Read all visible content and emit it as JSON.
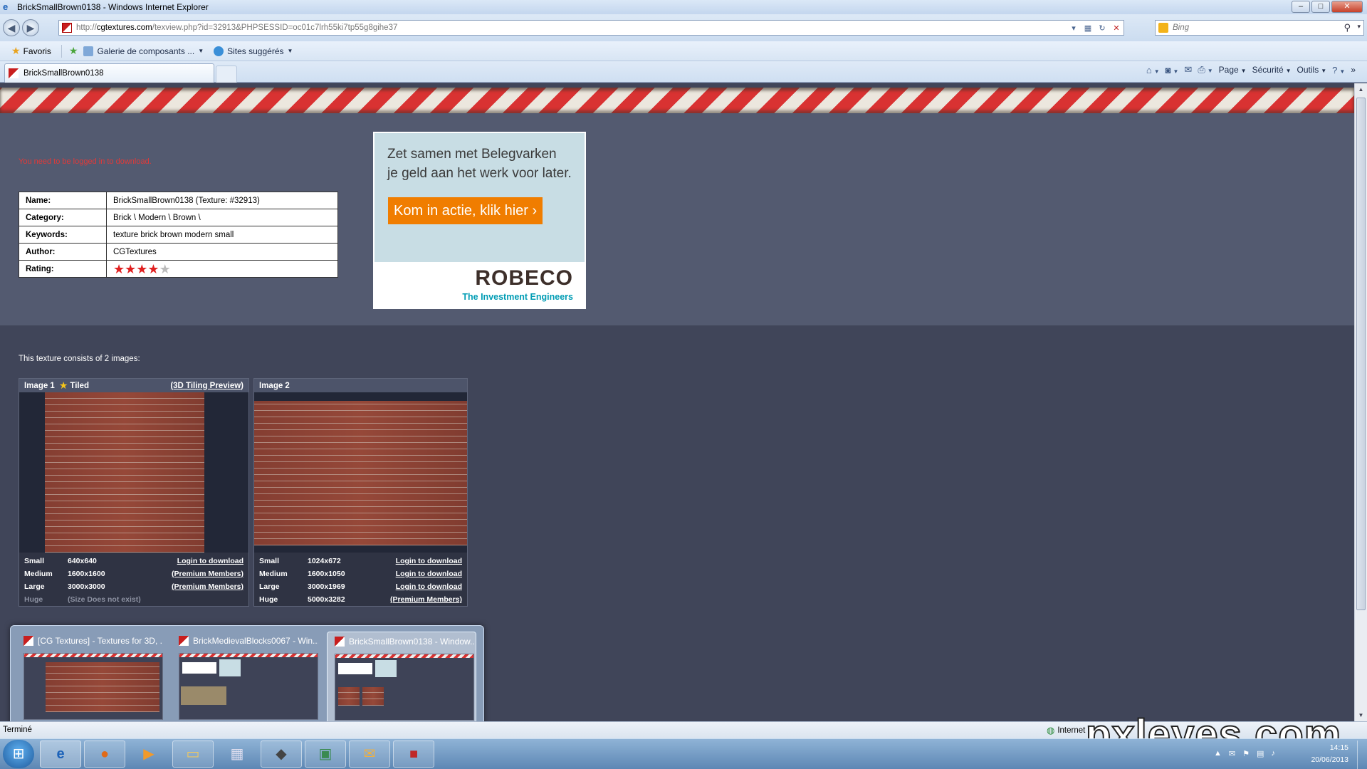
{
  "window": {
    "title": "BrickSmallBrown0138 - Windows Internet Explorer",
    "minimize": "–",
    "maximize": "□",
    "close": "✕"
  },
  "nav": {
    "back": "◀",
    "forward": "▶",
    "url_prefix": "http://",
    "url_host": "cgtextures.com",
    "url_path": "/texview.php?id=32913&PHPSESSID=oc01c7lrh55ki7tp55g8gihe37",
    "search_placeholder": "Bing"
  },
  "favorites": {
    "favorites_label": "Favoris",
    "items": [
      "Galerie de composants ...",
      "Sites suggérés"
    ]
  },
  "tab": {
    "label": "BrickSmallBrown0138"
  },
  "commands": {
    "page": "Page",
    "security": "Sécurité",
    "tools": "Outils",
    "help": "?",
    "more": "»"
  },
  "content": {
    "login_message": "You need to be logged in to download.",
    "info": [
      {
        "key": "Name:",
        "value": "BrickSmallBrown0138 (Texture: #32913)"
      },
      {
        "key": "Category:",
        "value": "Brick \\ Modern \\ Brown \\"
      },
      {
        "key": "Keywords:",
        "value": "texture brick brown modern small"
      },
      {
        "key": "Author:",
        "value": "CGTextures"
      },
      {
        "key": "Rating:",
        "value": ""
      }
    ],
    "rating": {
      "stars": 4,
      "max": 5
    },
    "consists": "This texture consists of 2 images:",
    "images": [
      {
        "title": "Image 1",
        "tiled": "Tiled",
        "preview_link": "(3D Tiling Preview)",
        "sizes": [
          {
            "size": "Small",
            "dim": "640x640",
            "action": "Login to download",
            "available": true
          },
          {
            "size": "Medium",
            "dim": "1600x1600",
            "action": "(Premium Members)",
            "available": true
          },
          {
            "size": "Large",
            "dim": "3000x3000",
            "action": "(Premium Members)",
            "available": true
          },
          {
            "size": "Huge",
            "dim": "(Size Does not exist)",
            "action": "",
            "available": false
          }
        ]
      },
      {
        "title": "Image 2",
        "sizes": [
          {
            "size": "Small",
            "dim": "1024x672",
            "action": "Login to download",
            "available": true
          },
          {
            "size": "Medium",
            "dim": "1600x1050",
            "action": "Login to download",
            "available": true
          },
          {
            "size": "Large",
            "dim": "3000x1969",
            "action": "Login to download",
            "available": true
          },
          {
            "size": "Huge",
            "dim": "5000x3282",
            "action": "(Premium Members)",
            "available": true
          }
        ]
      }
    ]
  },
  "ad": {
    "headline_1": "Zet samen met Belegvarken",
    "headline_2": "je geld aan het werk voor later.",
    "cta": "Kom in actie, klik hier ›",
    "logo": "ROBECO",
    "tagline": "The Investment Engineers"
  },
  "switcher": {
    "items": [
      {
        "label": "[CG Textures] - Textures for 3D, ..."
      },
      {
        "label": "BrickMedievalBlocks0067 - Win..."
      },
      {
        "label": "BrickSmallBrown0138 - Window..."
      }
    ]
  },
  "status": {
    "text": "Terminé",
    "zone": "Internet"
  },
  "taskbar": {
    "time": "14:15",
    "date": "20/06/2013"
  },
  "watermark": "pxleyes.com",
  "colors": {
    "page_bg": "#404559",
    "top_area_bg": "#535a70",
    "login_red": "#e03a3a",
    "star_red": "#e02020",
    "ad_orange": "#f07d00",
    "robeco_teal": "#009cb4"
  }
}
